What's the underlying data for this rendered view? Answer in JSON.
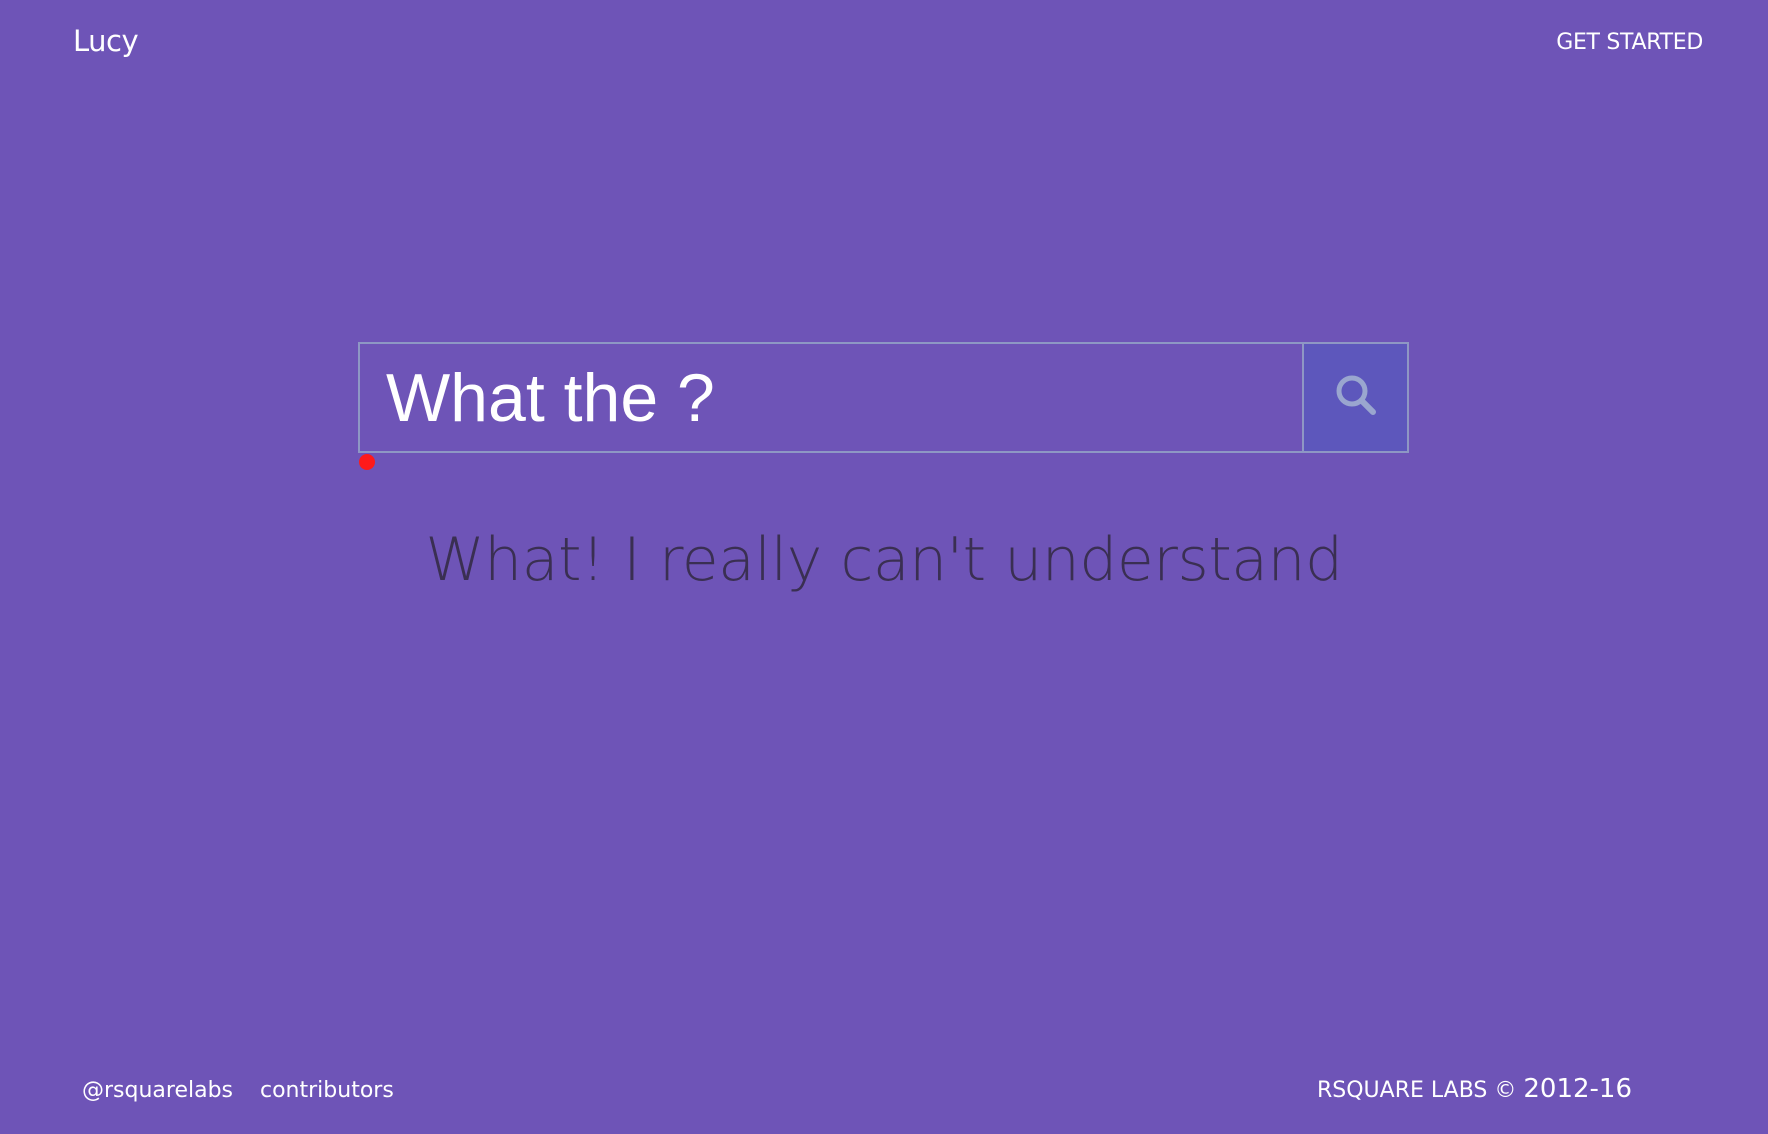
{
  "header": {
    "brand": "Lucy",
    "get_started_label": "GET STARTED"
  },
  "search": {
    "value": "What the ?",
    "button_icon": "search-icon"
  },
  "response": {
    "text": "What! I really can't understand"
  },
  "footer": {
    "twitter_link": "@rsquarelabs",
    "contributors_link": "contributors",
    "copyright_org": "RSQUARE LABS ©",
    "copyright_years": "2012-16"
  },
  "colors": {
    "background": "#6e54b7",
    "search_button": "#5d57bc",
    "border": "#8e97c4",
    "response_text": "#3a2f52",
    "cursor_marker": "#ff1a1a"
  }
}
